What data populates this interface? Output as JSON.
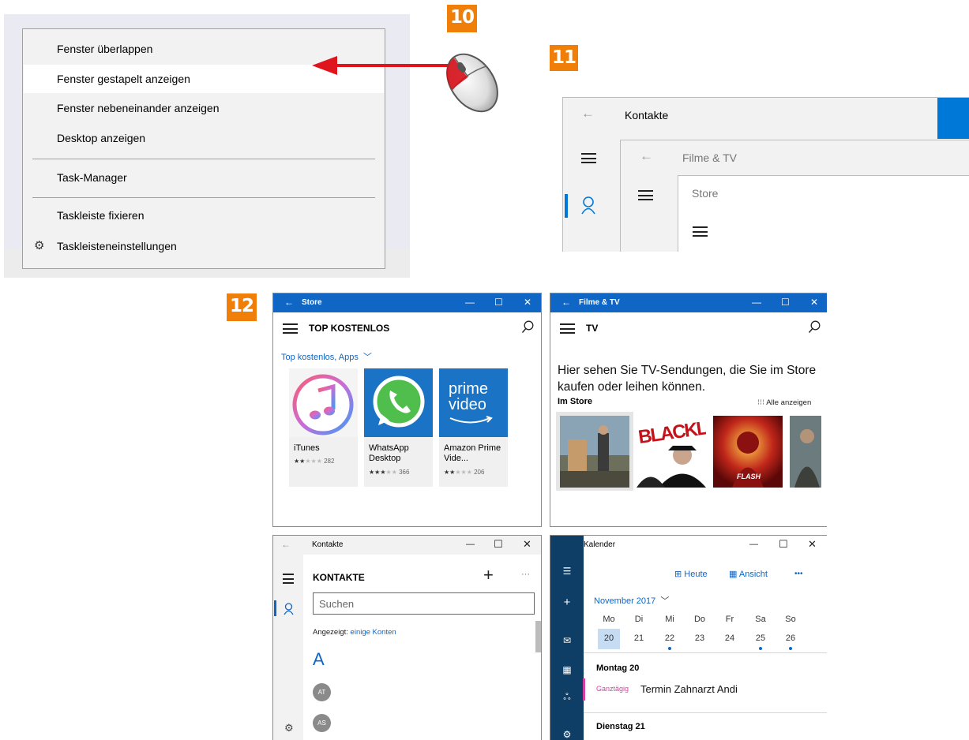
{
  "steps": {
    "s10": "10",
    "s11": "11",
    "s12": "12"
  },
  "context_menu": {
    "items": [
      {
        "label": "Fenster überlappen"
      },
      {
        "label": "Fenster gestapelt anzeigen"
      },
      {
        "label": "Fenster nebeneinander anzeigen"
      },
      {
        "label": "Desktop anzeigen"
      },
      {
        "label": "Task-Manager"
      },
      {
        "label": "Taskleiste fixieren"
      },
      {
        "label": "Taskleisteneinstellungen"
      }
    ],
    "highlighted_index": 1,
    "settings_icon": "gear-icon"
  },
  "stacked_preview": {
    "windows": [
      "Kontakte",
      "Filme & TV",
      "Store"
    ],
    "accent": "#0078d7"
  },
  "store": {
    "title": "Store",
    "heading": "TOP KOSTENLOS",
    "filter": "Top kostenlos, Apps",
    "apps": [
      {
        "name": "iTunes",
        "stars": "★★★★★",
        "rating_count": "282",
        "rating": 2
      },
      {
        "name": "WhatsApp Desktop",
        "stars": "★★★★★",
        "rating_count": "366",
        "rating": 3
      },
      {
        "name": "Amazon Prime Vide...",
        "stars": "★★★★★",
        "rating_count": "206",
        "rating": 2
      }
    ],
    "prime_text": {
      "line1": "prime",
      "line2": "video"
    }
  },
  "films": {
    "title": "Filme & TV",
    "heading": "TV",
    "message": "Hier sehen Sie TV-Sendungen, die Sie im Store kaufen oder leihen können.",
    "message_line1": "Hier sehen Sie TV-Sendungen, die Sie im Store",
    "message_line2": "kaufen oder leihen können.",
    "section": "Im Store",
    "see_all": "Alle anzeigen",
    "poster_text": {
      "blacklist": "BLACKLIST",
      "flash": "FLASH"
    }
  },
  "contacts": {
    "title": "Kontakte",
    "heading": "KONTAKTE",
    "search_placeholder": "Suchen",
    "shown_label": "Angezeigt:",
    "shown_link": "einige Konten",
    "letter": "A",
    "avatars": [
      "AT",
      "AS"
    ]
  },
  "calendar": {
    "title": "Kalender",
    "today": "Heute",
    "view": "Ansicht",
    "more": "•••",
    "month": "November 2017",
    "weekdays": [
      "Mo",
      "Di",
      "Mi",
      "Do",
      "Fr",
      "Sa",
      "So"
    ],
    "days": [
      "20",
      "21",
      "22",
      "23",
      "24",
      "25",
      "26"
    ],
    "event_days": [
      "22",
      "25",
      "26"
    ],
    "day1": "Montag 20",
    "allday": "Ganztägig",
    "event": "Termin Zahnarzt Andi",
    "day2": "Dienstag 21",
    "accent": "#1066c4",
    "sidebar_color": "#0e3e66"
  },
  "window_controls": {
    "minimize": "—",
    "maximize": "☐",
    "close": "✕",
    "back": "←"
  }
}
